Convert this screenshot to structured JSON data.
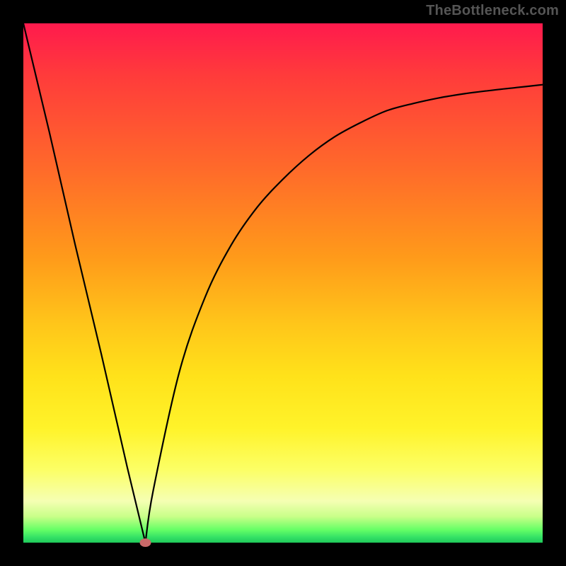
{
  "watermark": "TheBottleneck.com",
  "colors": {
    "frame": "#000000",
    "curve": "#000000",
    "marker": "#c96a6a",
    "gradient_top": "#ff1a4d",
    "gradient_bottom": "#1fc95a"
  },
  "chart_data": {
    "type": "line",
    "title": "",
    "xlabel": "",
    "ylabel": "",
    "xlim": [
      0,
      100
    ],
    "ylim": [
      0,
      110
    ],
    "grid": false,
    "legend": false,
    "series": [
      {
        "name": "bottleneck-curve",
        "x": [
          0,
          5,
          10,
          15,
          20,
          23.5,
          25,
          30,
          35,
          40,
          45,
          50,
          55,
          60,
          65,
          70,
          75,
          80,
          85,
          90,
          95,
          100
        ],
        "values": [
          110,
          87,
          63,
          40,
          16,
          0,
          11,
          36,
          52,
          63,
          71,
          77,
          82,
          86,
          89,
          91.5,
          93,
          94.2,
          95.1,
          95.8,
          96.4,
          97
        ]
      }
    ],
    "annotations": [
      {
        "type": "point",
        "name": "minimum-marker",
        "x": 23.5,
        "y": 0
      }
    ]
  }
}
